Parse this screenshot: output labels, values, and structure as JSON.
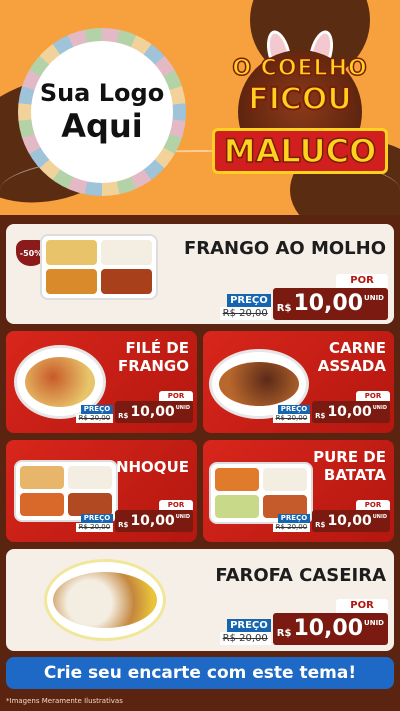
{
  "logo": {
    "line1": "Sua Logo",
    "line2": "Aqui"
  },
  "theme": {
    "line1": "O COELHO",
    "line2": "FICOU",
    "line3": "MALUCO"
  },
  "discount_badge": "-50%",
  "items": [
    {
      "name_l1": "FRANGO AO MOLHO",
      "name_l2": "",
      "price_label": "PREÇO",
      "old_price": "R$ 20,00",
      "por": "POR",
      "currency": "R$",
      "price": "10,00",
      "unit": "UNID"
    },
    {
      "name_l1": "FILÉ DE",
      "name_l2": "FRANGO",
      "price_label": "PREÇO",
      "old_price": "R$ 20,00",
      "por": "POR",
      "currency": "R$",
      "price": "10,00",
      "unit": "UNID"
    },
    {
      "name_l1": "CARNE",
      "name_l2": "ASSADA",
      "price_label": "PREÇO",
      "old_price": "R$ 20,00",
      "por": "POR",
      "currency": "R$",
      "price": "10,00",
      "unit": "UNID"
    },
    {
      "name_l1": "NHOQUE",
      "name_l2": "",
      "price_label": "PREÇO",
      "old_price": "R$ 20,00",
      "por": "POR",
      "currency": "R$",
      "price": "10,00",
      "unit": "UNID"
    },
    {
      "name_l1": "PURE DE",
      "name_l2": "BATATA",
      "price_label": "PREÇO",
      "old_price": "R$ 20,00",
      "por": "POR",
      "currency": "R$",
      "price": "10,00",
      "unit": "UNID"
    },
    {
      "name_l1": "FAROFA CASEIRA",
      "name_l2": "",
      "price_label": "PREÇO",
      "old_price": "R$ 20,00",
      "por": "POR",
      "currency": "R$",
      "price": "10,00",
      "unit": "UNID"
    }
  ],
  "cta": "Crie seu encarte com este tema!",
  "disclaimer": "*Imagens Meramente Ilustrativas",
  "colors": {
    "orange": "#f6a13d",
    "brown": "#5b2410",
    "red": "#d9261c",
    "blue": "#1e69c6",
    "yellow": "#ffd21f"
  }
}
